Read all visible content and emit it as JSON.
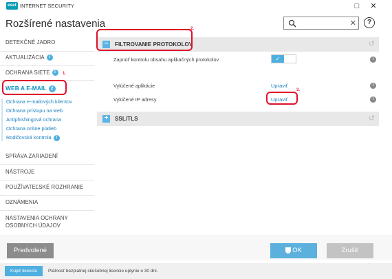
{
  "titlebar": {
    "logo": "eset",
    "title": "INTERNET SECURITY",
    "minimize": "□",
    "close": "✕"
  },
  "header": {
    "title": "Rozšírené nastavenia",
    "search": {
      "value": "",
      "placeholder": "",
      "clear": "✕"
    },
    "help": "?"
  },
  "sidebar": {
    "items": [
      {
        "label": "DETEKČNÉ JADRO"
      },
      {
        "label": "AKTUALIZÁCIA",
        "badge": "i"
      },
      {
        "label": "OCHRANA SIETE",
        "badge": "i"
      },
      {
        "label": "WEB A E-MAIL",
        "badge": "2",
        "active": true
      },
      {
        "label": "SPRÁVA ZARIADENÍ"
      },
      {
        "label": "NÁSTROJE"
      },
      {
        "label": "POUŽÍVATEĽSKÉ ROZHRANIE"
      },
      {
        "label": "OZNÁMENIA"
      },
      {
        "label": "NASTAVENIA OCHRANY",
        "label2": "OSOBNÝCH ÚDAJOV"
      }
    ],
    "subitems": [
      {
        "label": "Ochrana e-mailových klientov"
      },
      {
        "label": "Ochrana prístupu na web"
      },
      {
        "label": "Antiphishingová ochrana"
      },
      {
        "label": "Ochrana online platieb"
      },
      {
        "label": "Rodičovská kontrola",
        "badge": "i"
      }
    ]
  },
  "content": {
    "sections": [
      {
        "label": "FILTROVANIE PROTOKOLOV",
        "toggle": "−",
        "rows": [
          {
            "label": "Zapnúť kontrolu obsahu aplikačných protokolov",
            "toggle": "✓",
            "info": "i"
          },
          {
            "label": "Vylúčené aplikácie",
            "link": "Upraviť",
            "info": "i"
          },
          {
            "label": "Vylúčené IP adresy",
            "link": "Upraviť",
            "info": "i"
          }
        ]
      },
      {
        "label": "SSL/TLS",
        "toggle": "+"
      }
    ],
    "revert": "↺"
  },
  "annotations": [
    "1.",
    "2.",
    "3."
  ],
  "footer": {
    "default_label": "Predvolené",
    "ok_label": "OK",
    "cancel_label": "Zrušiť"
  },
  "statusbar": {
    "buy_label": "Kúpiť licenciu",
    "text": "Platnosť bezplatnej skúšobnej licencie uplynie o 30 dní."
  },
  "colors": {
    "accent": "#4fb0e0",
    "active_text": "#0a8fbf",
    "annotation": "#e0102a"
  }
}
